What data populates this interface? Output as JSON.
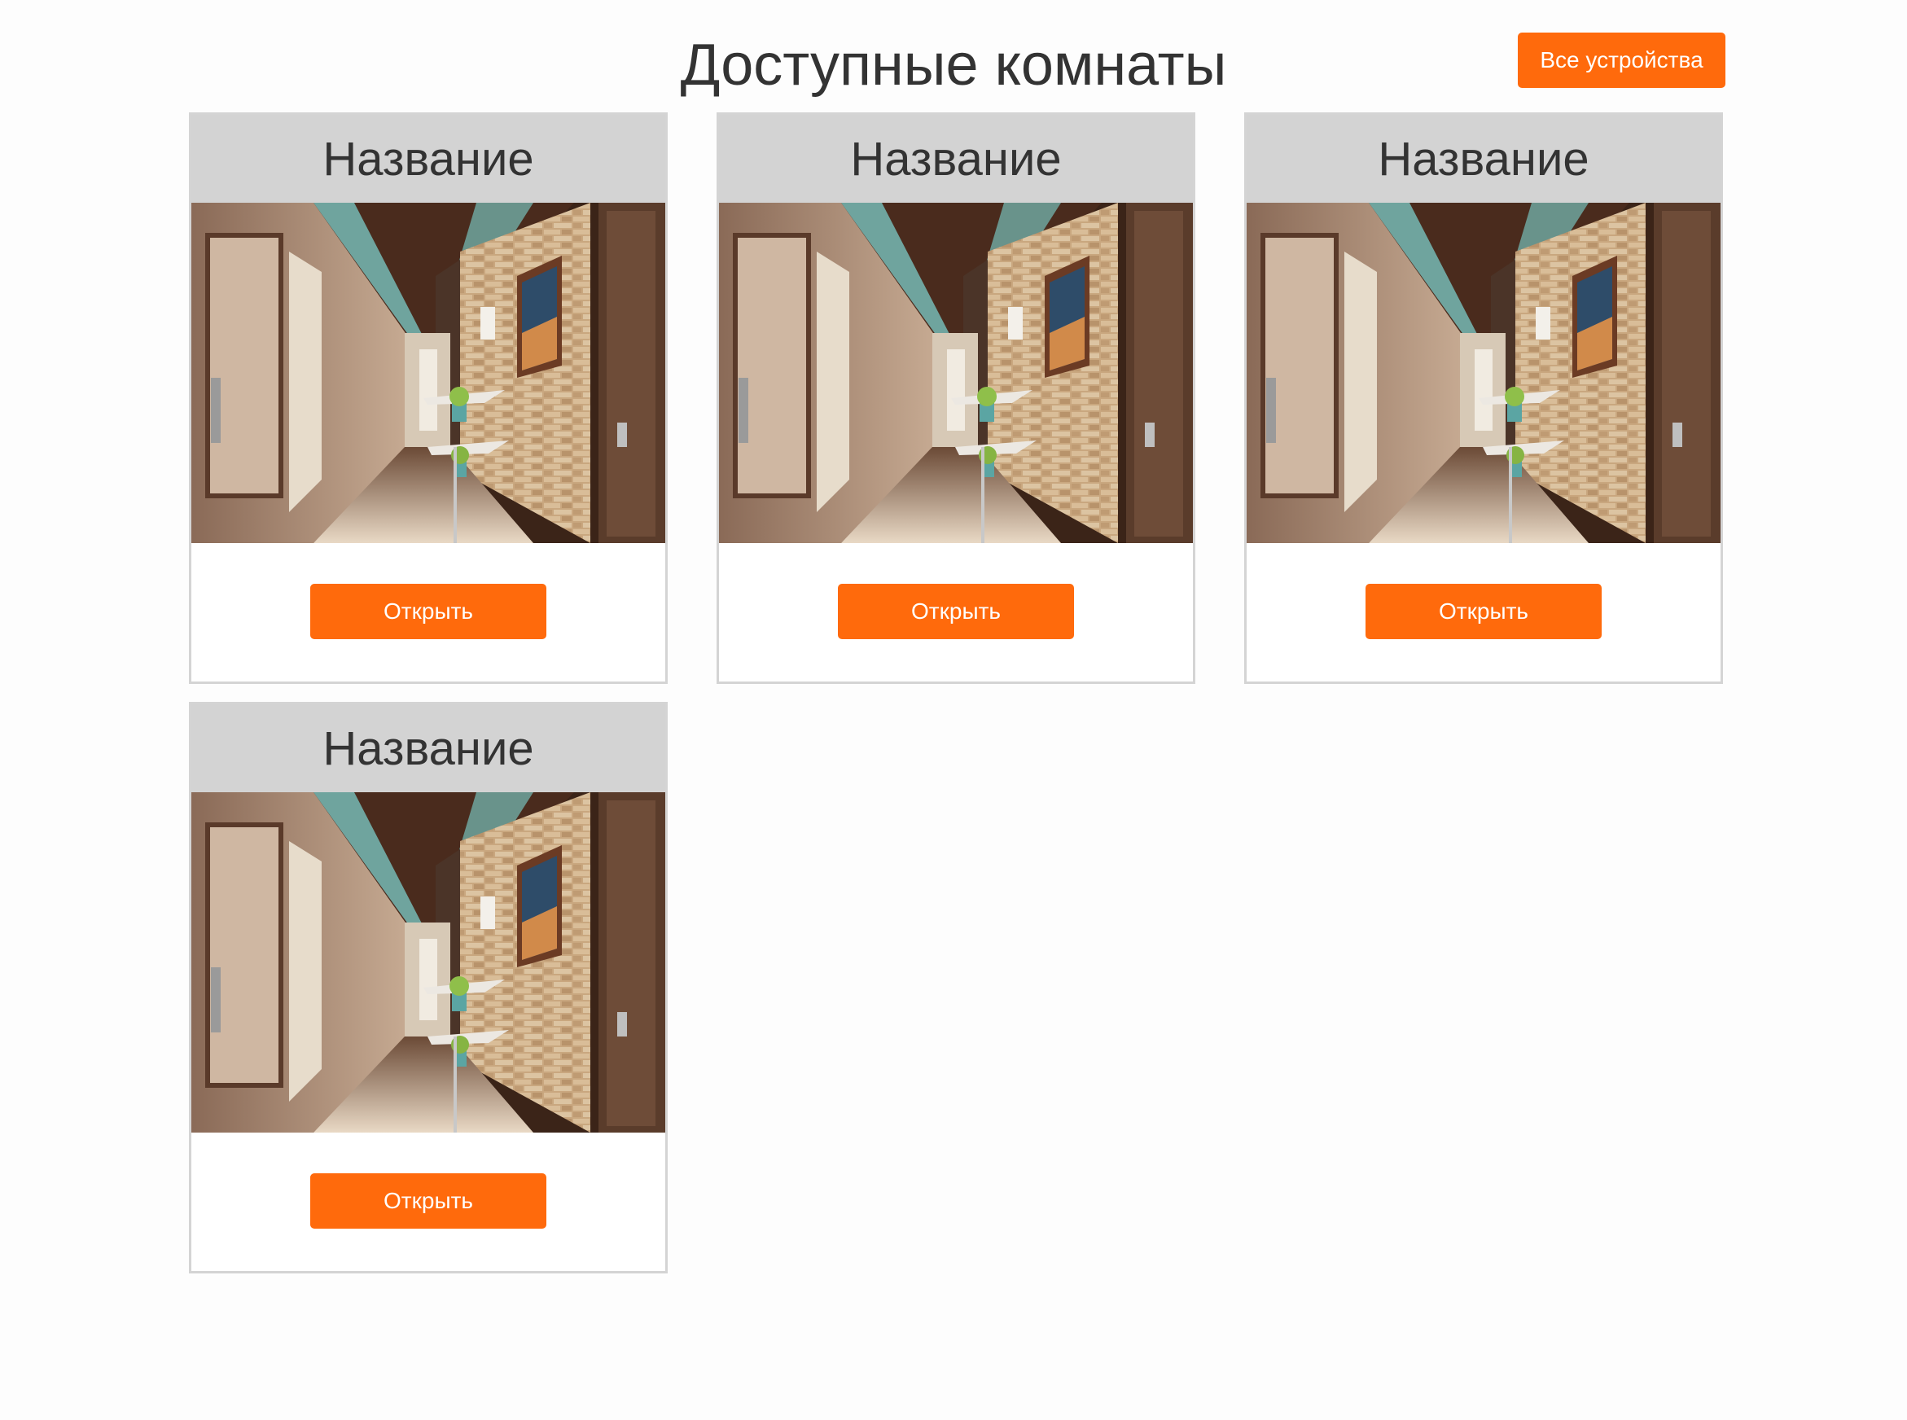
{
  "header": {
    "title": "Доступные комнаты",
    "all_devices_label": "Все устройства"
  },
  "rooms": [
    {
      "name": "Название",
      "image": "hallway-interior-photo",
      "open_label": "Открыть"
    },
    {
      "name": "Название",
      "image": "hallway-interior-photo",
      "open_label": "Открыть"
    },
    {
      "name": "Название",
      "image": "hallway-interior-photo",
      "open_label": "Открыть"
    },
    {
      "name": "Название",
      "image": "hallway-interior-photo",
      "open_label": "Открыть"
    }
  ],
  "colors": {
    "accent": "#ff6a0c",
    "card_header_bg": "#d3d3d3",
    "card_border": "#d4d4d4",
    "text": "#333333"
  }
}
